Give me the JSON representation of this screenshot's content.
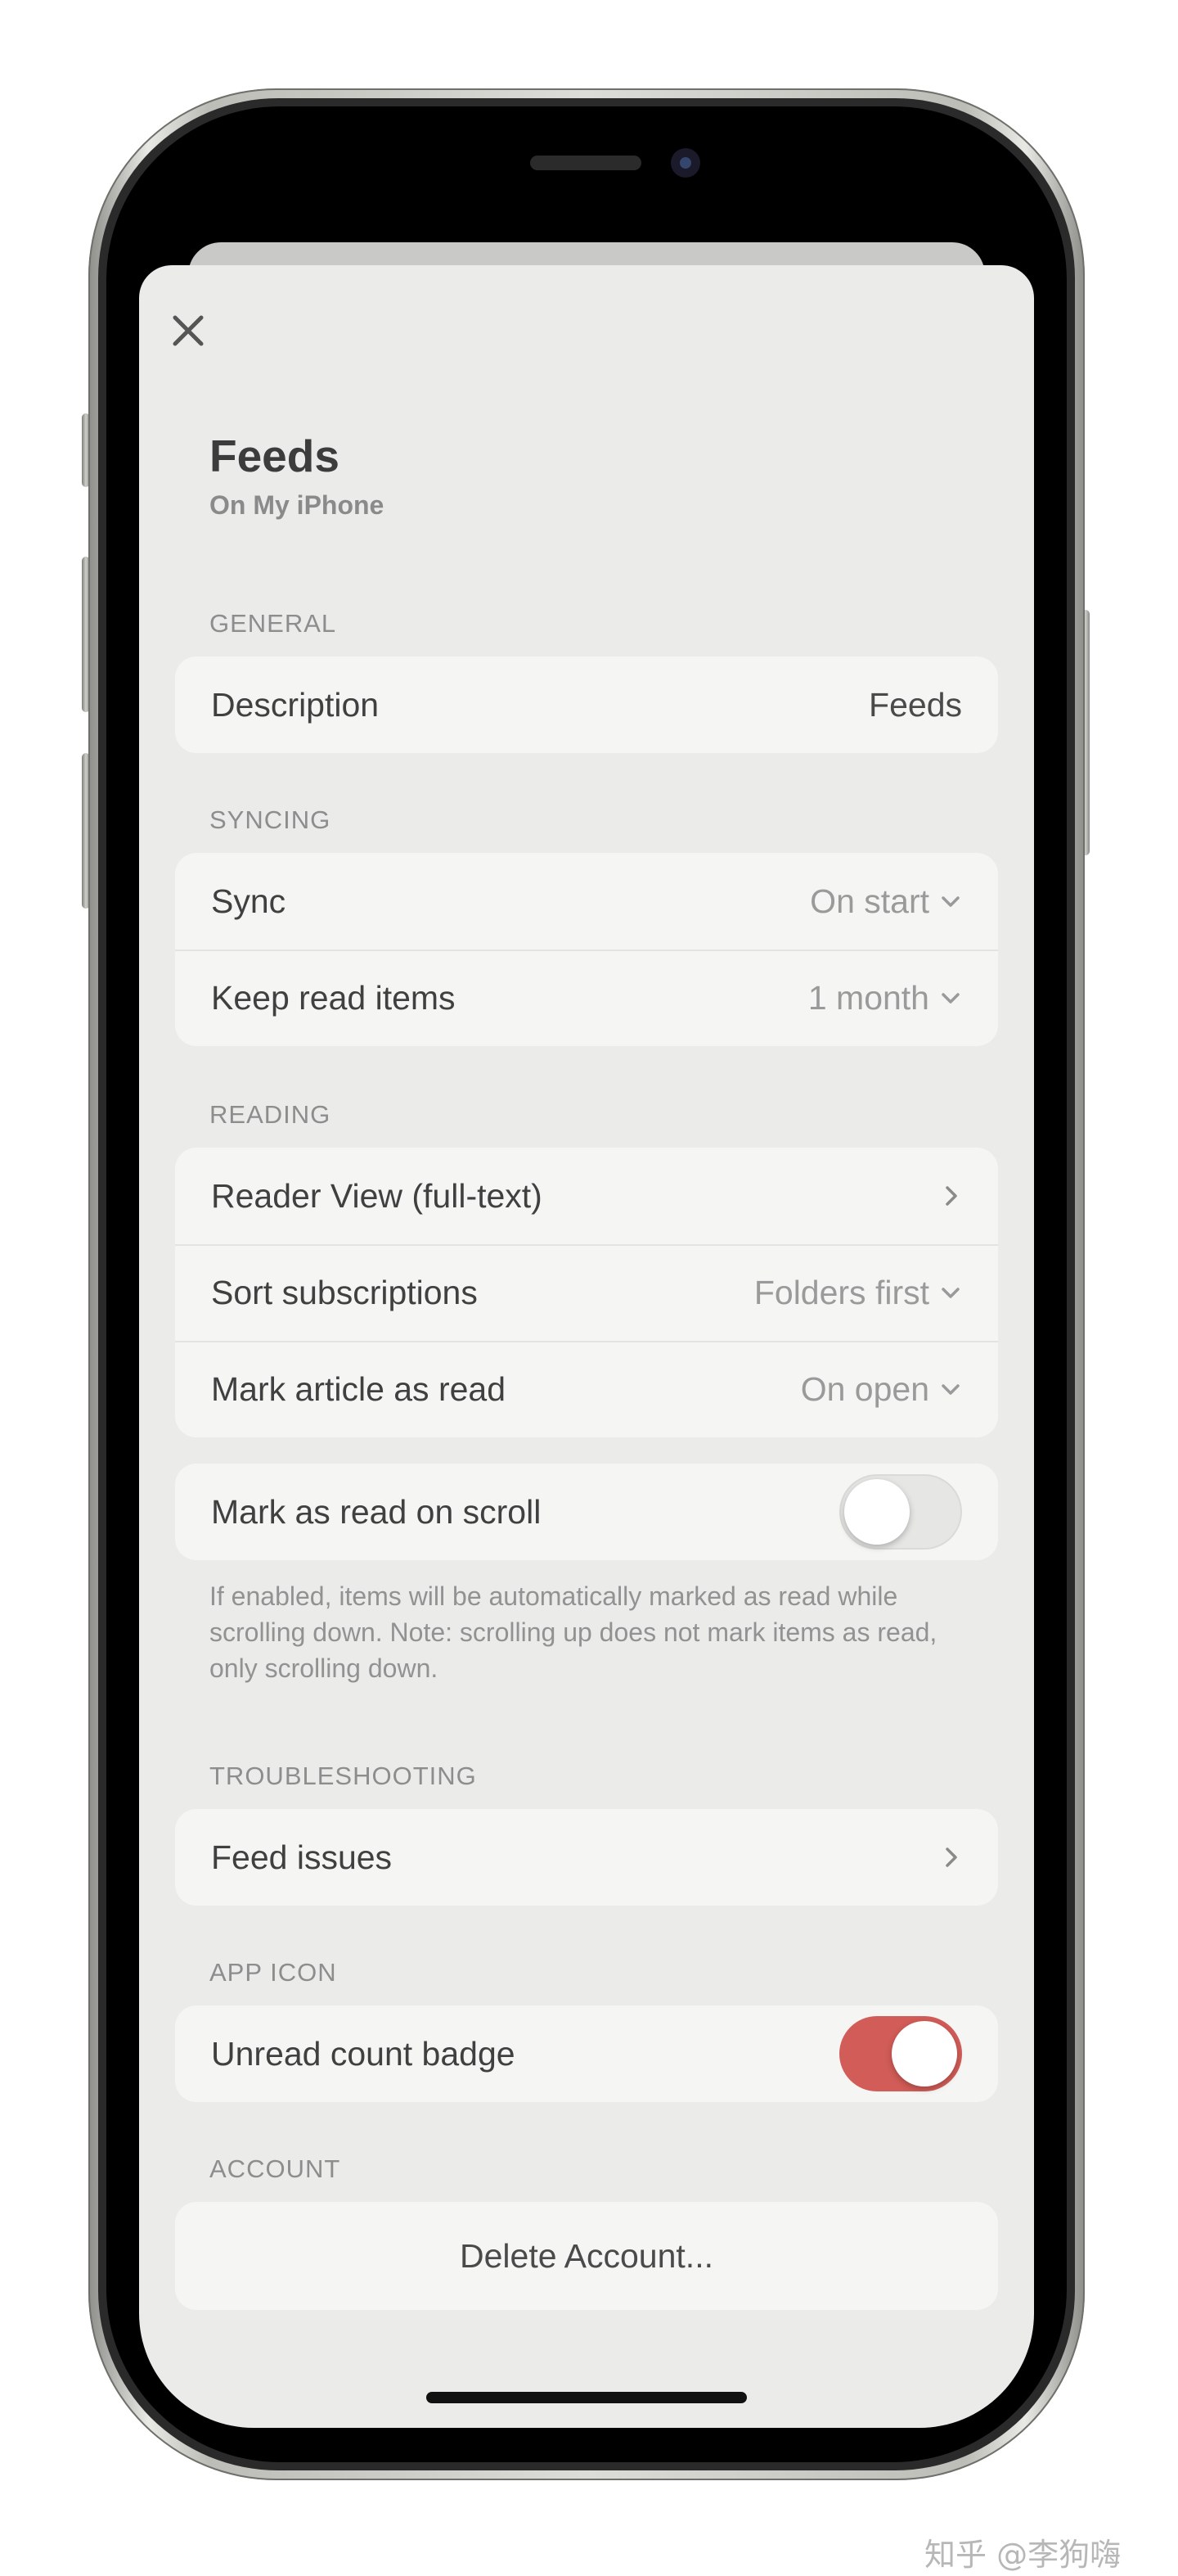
{
  "header": {
    "title": "Feeds",
    "subtitle": "On My iPhone"
  },
  "sections": {
    "general": {
      "label": "GENERAL",
      "rows": [
        {
          "label": "Description",
          "value": "Feeds"
        }
      ]
    },
    "syncing": {
      "label": "SYNCING",
      "rows": [
        {
          "label": "Sync",
          "value": "On start"
        },
        {
          "label": "Keep read items",
          "value": "1 month"
        }
      ]
    },
    "reading": {
      "label": "READING",
      "rows": [
        {
          "label": "Reader View (full-text)"
        },
        {
          "label": "Sort subscriptions",
          "value": "Folders first"
        },
        {
          "label": "Mark article as read",
          "value": "On open"
        }
      ],
      "scroll_toggle": {
        "label": "Mark as read on scroll",
        "enabled": false
      },
      "footnote": "If enabled, items will be automatically marked as read while scrolling down. Note: scrolling up does not mark items as read, only scrolling down."
    },
    "troubleshooting": {
      "label": "TROUBLESHOOTING",
      "rows": [
        {
          "label": "Feed issues"
        }
      ]
    },
    "app_icon": {
      "label": "APP ICON",
      "badge_toggle": {
        "label": "Unread count badge",
        "enabled": true
      }
    },
    "account": {
      "label": "ACCOUNT",
      "delete_label": "Delete Account..."
    }
  },
  "icons": {
    "close": "close-icon",
    "chevron_down": "chevron-down-icon",
    "chevron_right": "chevron-right-icon"
  },
  "colors": {
    "accent_toggle_on": "#d25c57",
    "sheet_background": "#ebebea",
    "group_background": "#f5f5f3"
  },
  "watermark": "知乎 @李狗嗨"
}
